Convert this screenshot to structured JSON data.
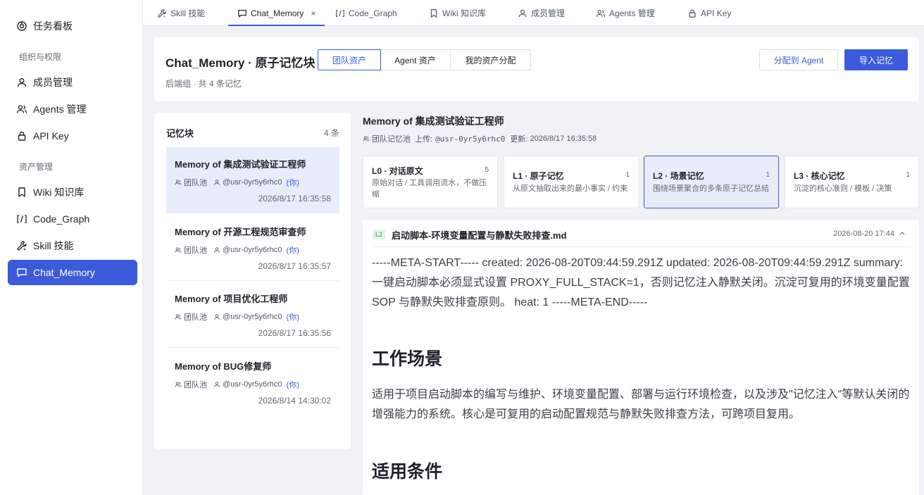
{
  "sidebar": {
    "items": [
      {
        "label": "任务看板",
        "icon": "dashboard-icon"
      },
      {
        "label": "成员管理",
        "icon": "user-icon"
      },
      {
        "label": "Agents 管理",
        "icon": "users-icon"
      },
      {
        "label": "API Key",
        "icon": "lock-icon"
      },
      {
        "label": "Wiki 知识库",
        "icon": "bookmark-icon"
      },
      {
        "label": "Code_Graph",
        "icon": "code-icon"
      },
      {
        "label": "Skill 技能",
        "icon": "wrench-icon"
      },
      {
        "label": "Chat_Memory",
        "icon": "chat-icon"
      }
    ],
    "groups": {
      "org": "组织与权限",
      "assets": "资产管理"
    }
  },
  "tabs": [
    {
      "label": "Skill 技能",
      "icon": "wrench-icon"
    },
    {
      "label": "Chat_Memory",
      "icon": "chat-icon",
      "close": "×"
    },
    {
      "label": "Code_Graph",
      "icon": "code-icon"
    },
    {
      "label": "Wiki 知识库",
      "icon": "bookmark-icon"
    },
    {
      "label": "成员管理",
      "icon": "user-icon"
    },
    {
      "label": "Agents 管理",
      "icon": "users-icon"
    },
    {
      "label": "API Key",
      "icon": "lock-icon"
    }
  ],
  "header": {
    "title": "Chat_Memory · 原子记忆块",
    "subtitle": "后端组 · 共 4 条记忆",
    "segments": [
      "团队资产",
      "Agent 资产",
      "我的资产分配"
    ],
    "assign_button": "分配到 Agent",
    "import_button": "导入记忆"
  },
  "memory_list": {
    "title": "记忆块",
    "count": "4 条",
    "items": [
      {
        "name": "Memory of 集成测试验证工程师",
        "pool": "团队池",
        "user": "@usr-0yr5y6rhc0",
        "you": "(你)",
        "time": "2026/8/17 16:35:58"
      },
      {
        "name": "Memory of 开源工程规范审查师",
        "pool": "团队池",
        "user": "@usr-0yr5y6rhc0",
        "you": "(你)",
        "time": "2026/8/17 16:35:57"
      },
      {
        "name": "Memory of 项目优化工程师",
        "pool": "团队池",
        "user": "@usr-0yr5y6rhc0",
        "you": "(你)",
        "time": "2026/8/17 16:35:56"
      },
      {
        "name": "Memory of BUG修复师",
        "pool": "团队池",
        "user": "@usr-0yr5y6rhc0",
        "you": "(你)",
        "time": "2026/8/14 14:30:02"
      }
    ]
  },
  "detail": {
    "title": "Memory of 集成测试验证工程师",
    "pool": "团队记忆池",
    "upload_label": "上传:",
    "upload_user": "@usr-0yr5y6rhc0",
    "updated_label": "更新:",
    "updated_time": "2026/8/17 16:35:58",
    "levels": [
      {
        "name": "L0 · 对话原文",
        "count": "5",
        "desc": "原始对话 / 工具调用流水，不做压缩"
      },
      {
        "name": "L1 · 原子记忆",
        "count": "1",
        "desc": "从原文抽取出来的最小事实 / 约束"
      },
      {
        "name": "L2 · 场景记忆",
        "count": "1",
        "desc": "围绕场景聚合的多条原子记忆总结"
      },
      {
        "name": "L3 · 核心记忆",
        "count": "1",
        "desc": "沉淀的核心准则 / 模板 / 决策"
      }
    ],
    "file": {
      "tag": "L2",
      "name": "启动脚本-环境变量配置与静默失败排查.md",
      "date": "2026-08-20 17:44",
      "meta": "-----META-START----- created: 2026-08-20T09:44:59.291Z updated: 2026-08-20T09:44:59.291Z summary: 一键启动脚本必须显式设置 PROXY_FULL_STACK=1，否则记忆注入静默关闭。沉淀可复用的环境变量配置 SOP 与静默失败排查原则。 heat: 1 -----META-END-----",
      "h_scene": "工作场景",
      "p_scene": "适用于项目启动脚本的编写与维护、环境变量配置、部署与运行环境检查，以及涉及\"记忆注入\"等默认关闭的增强能力的系统。核心是可复用的启动配置规范与静默失败排查方法，可跨项目复用。",
      "h_cond": "适用条件"
    }
  },
  "colors": {
    "accent": "#3b5bdb",
    "selected_bg": "#e8edfc",
    "tag_green": "#2e9e55"
  }
}
